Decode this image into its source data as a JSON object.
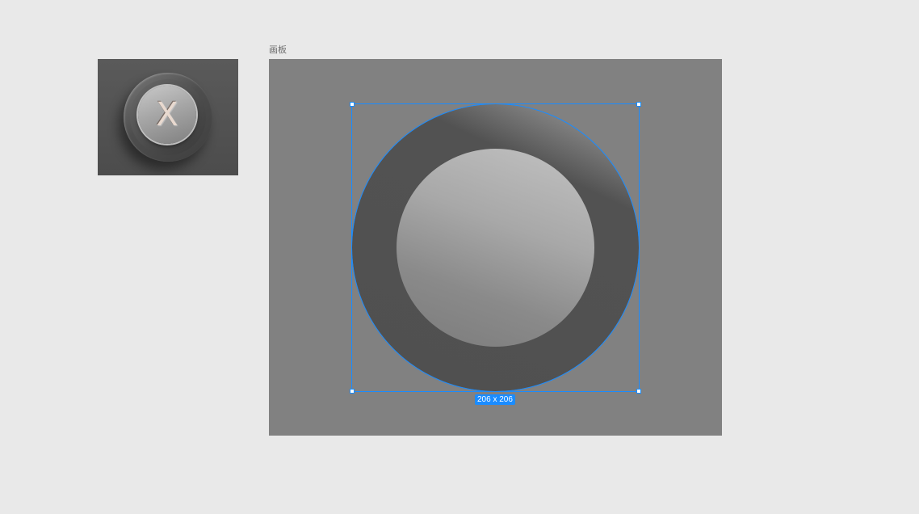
{
  "thumbnail": {
    "label": "X",
    "label_color": "#e8d9cf"
  },
  "artboard": {
    "name": "画板",
    "background": "#818181"
  },
  "selection": {
    "size_label": "206 x 206",
    "accent_color": "#1a8cff"
  },
  "canvas_background": "#e9e9e9"
}
